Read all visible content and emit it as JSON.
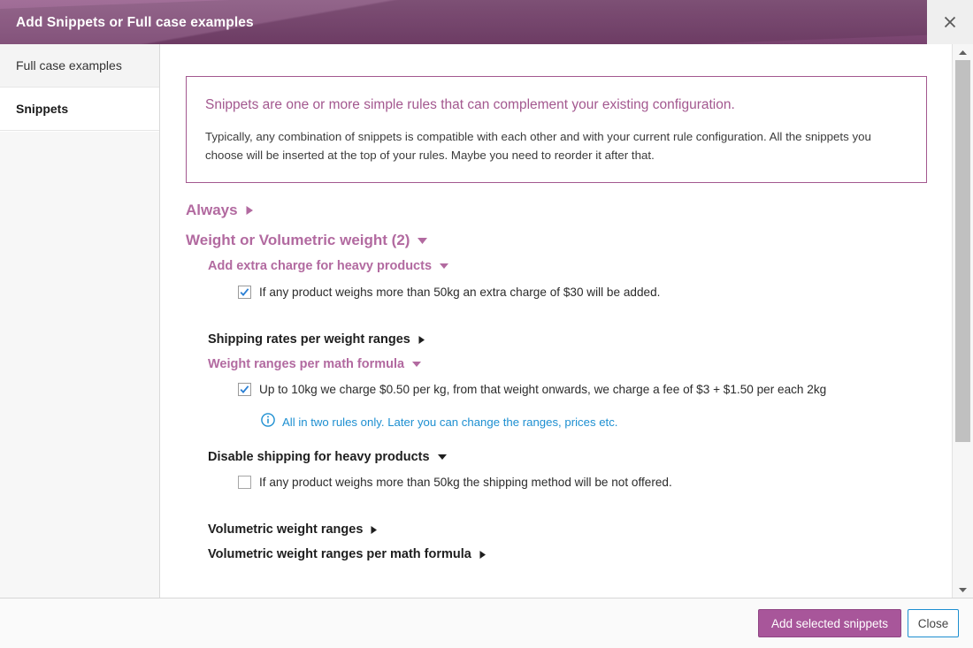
{
  "window": {
    "title": "Add Snippets or Full case examples",
    "close_icon": "close-icon",
    "accent_purple": "#a3588f",
    "header_purple": "#8b4d80",
    "info_blue": "#1d8fd1"
  },
  "sidebar": {
    "items": [
      {
        "label": "Full case examples",
        "active": false
      },
      {
        "label": "Snippets",
        "active": true
      }
    ]
  },
  "notice": {
    "title": "Snippets are one or more simple rules that can complement your existing configuration.",
    "body": "Typically, any combination of snippets is compatible with each other and with your current rule configuration. All the snippets you choose will be inserted at the top of your rules. Maybe you need to reorder it after that."
  },
  "tree": {
    "always": {
      "label": "Always",
      "caret": "right-caret-icon",
      "expanded": false
    },
    "weight_group": {
      "label": "Weight or Volumetric weight (2)",
      "caret": "down-caret-icon",
      "expanded": true
    },
    "extra_charge": {
      "label": "Add extra charge for heavy products",
      "caret": "down-caret-icon",
      "expanded": true
    },
    "extra_charge_option": {
      "label": "If any product weighs more than 50kg an extra charge of $30 will be added.",
      "checked": true
    },
    "shipping_rates": {
      "label": "Shipping rates per weight ranges",
      "caret": "right-caret-icon",
      "expanded": false
    },
    "weight_ranges_formula": {
      "label": "Weight ranges per math formula",
      "caret": "down-caret-icon",
      "expanded": true
    },
    "weight_ranges_option": {
      "label": "Up to 10kg we charge $0.50 per kg, from that weight onwards, we charge a fee of $3 + $1.50 per each 2kg",
      "checked": true
    },
    "weight_ranges_info": {
      "icon": "info-circle-icon",
      "text": "All in two rules only. Later you can change the ranges, prices etc."
    },
    "disable_shipping": {
      "label": "Disable shipping for heavy products",
      "caret": "down-caret-icon",
      "expanded": true
    },
    "disable_shipping_option": {
      "label": "If any product weighs more than 50kg the shipping method will be not offered.",
      "checked": false
    },
    "volumetric_ranges": {
      "label": "Volumetric weight ranges",
      "caret": "right-caret-icon",
      "expanded": false
    },
    "volumetric_formula": {
      "label": "Volumetric weight ranges per math formula",
      "caret": "right-caret-icon",
      "expanded": false
    }
  },
  "footer": {
    "primary_label": "Add selected snippets",
    "secondary_label": "Close"
  },
  "scrollbar": {
    "up_icon": "scroll-up-arrow-icon",
    "down_icon": "scroll-down-arrow-icon",
    "thumb": "scrollbar-thumb"
  }
}
